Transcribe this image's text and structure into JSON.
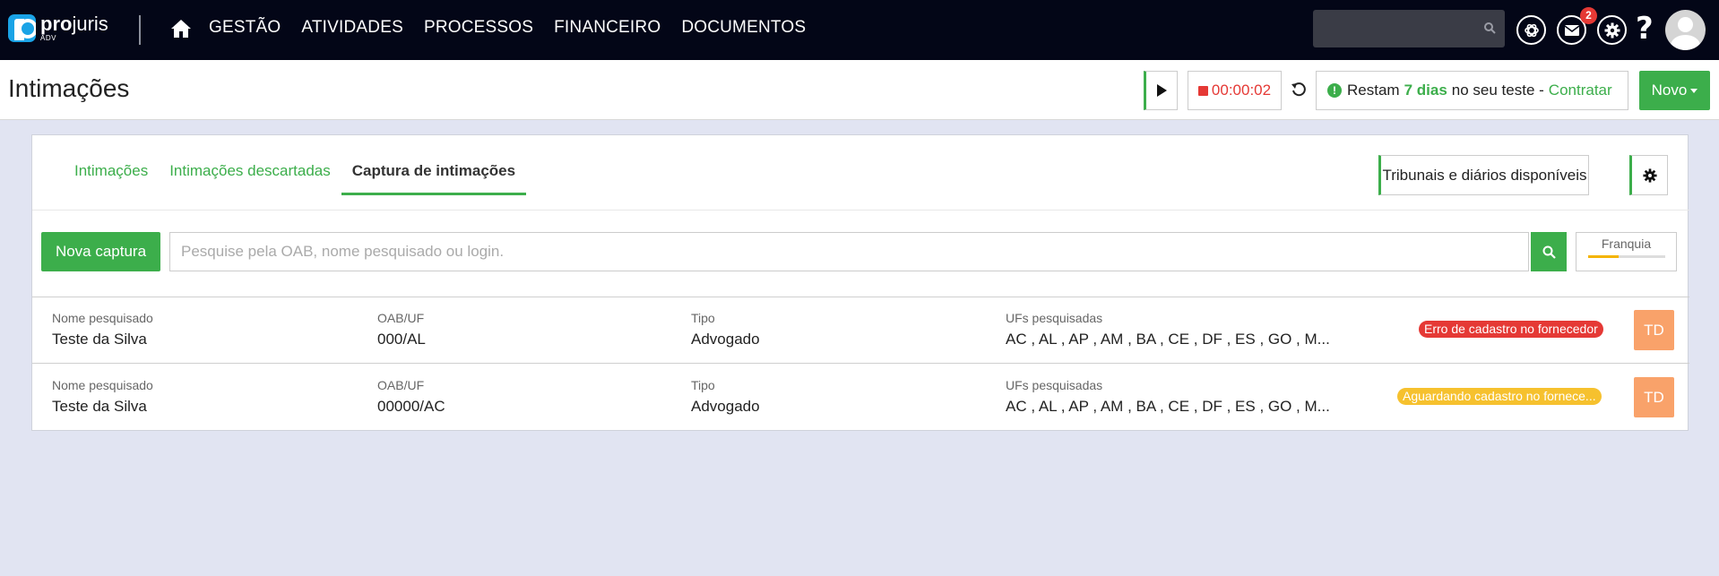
{
  "nav": {
    "logo_brand_bold": "pro",
    "logo_brand_rest": "juris",
    "logo_sub": "ADV",
    "links": [
      "GESTÃO",
      "ATIVIDADES",
      "PROCESSOS",
      "FINANCEIRO",
      "DOCUMENTOS"
    ],
    "mail_badge": "2",
    "help": "?"
  },
  "header": {
    "title": "Intimações",
    "timer": "00:00:02",
    "trial_prefix": "Restam",
    "trial_days": "7 dias",
    "trial_suffix": "no seu teste -",
    "trial_link": "Contratar",
    "novo_label": "Novo"
  },
  "tabs": [
    {
      "label": "Intimações"
    },
    {
      "label": "Intimações descartadas"
    },
    {
      "label": "Captura de intimações"
    }
  ],
  "tribunais_label": "Tribunais e diários disponíveis",
  "nova_captura_label": "Nova captura",
  "search": {
    "placeholder": "Pesquise pela OAB, nome pesquisado ou login."
  },
  "franquia": {
    "label": "Franquia",
    "usage_fraction": 0.4
  },
  "columns": {
    "nome": "Nome pesquisado",
    "oab": "OAB/UF",
    "tipo": "Tipo",
    "ufs": "UFs pesquisadas"
  },
  "rows": [
    {
      "nome": "Teste da Silva",
      "oab": "000/AL",
      "tipo": "Advogado",
      "ufs": "AC , AL , AP , AM , BA , CE , DF , ES , GO , M...",
      "status": "Erro de cadastro no fornecedor",
      "avatar": "TD"
    },
    {
      "nome": "Teste da Silva",
      "oab": "00000/AC",
      "tipo": "Advogado",
      "ufs": "AC , AL , AP , AM , BA , CE , DF , ES , GO , M...",
      "status": "Aguardando cadastro no fornece...",
      "avatar": "TD"
    }
  ],
  "colors": {
    "accent": "#3cae4b",
    "error": "#e53935",
    "warning": "#f6c12e",
    "avatar": "#f9a26a",
    "topbar": "#030617"
  }
}
